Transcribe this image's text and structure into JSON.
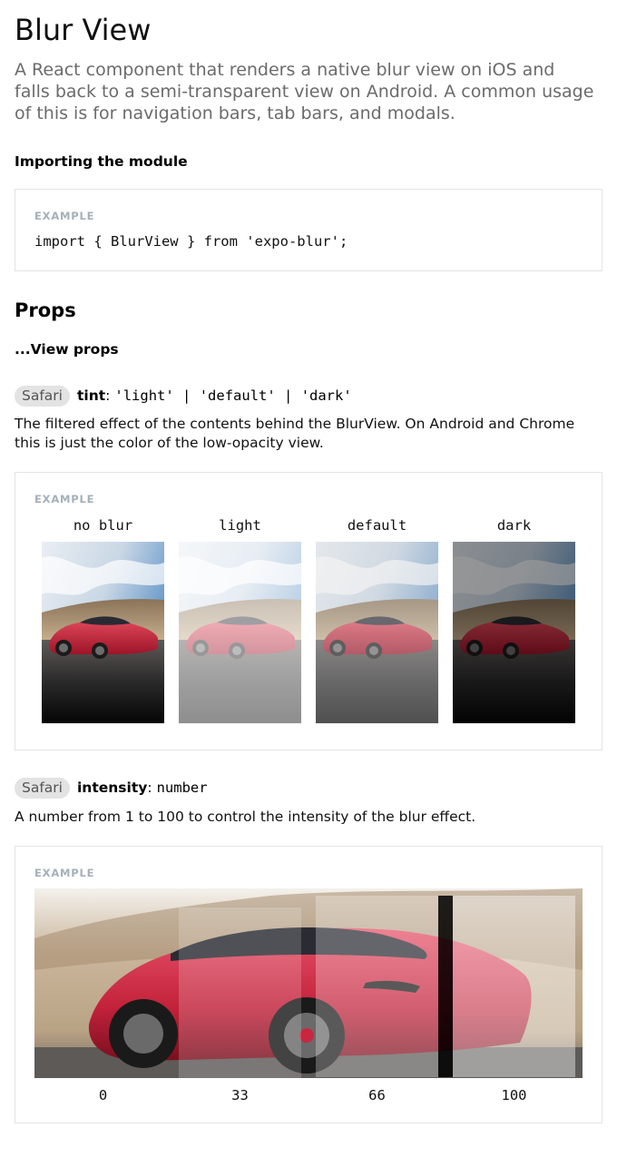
{
  "page": {
    "title": "Blur View",
    "lead": "A React component that renders a native blur view on iOS and falls back to a semi-transparent view on Android. A common usage of this is for navigation bars, tab bars, and modals."
  },
  "importing": {
    "heading": "Importing the module",
    "example_label": "EXAMPLE",
    "code": "import { BlurView } from 'expo-blur';"
  },
  "props": {
    "heading": "Props",
    "subheading": "...View props"
  },
  "tint": {
    "badge": "Safari",
    "name": "tint",
    "colon": ":",
    "type": "'light' | 'default' | 'dark'",
    "description": "The filtered effect of the contents behind the BlurView. On Android and Chrome this is just the color of the low-opacity view.",
    "example_label": "EXAMPLE",
    "variants": [
      "no blur",
      "light",
      "default",
      "dark"
    ]
  },
  "intensity": {
    "badge": "Safari",
    "name": "intensity",
    "colon": ":",
    "type": "number",
    "description": "A number from 1 to 100 to control the intensity of the blur effect.",
    "example_label": "EXAMPLE",
    "values": [
      "0",
      "33",
      "66",
      "100"
    ]
  },
  "colors": {
    "car_red": "#c8283f",
    "sky_blue": "#5b8fc3",
    "label_gray": "#a4b0ba",
    "badge_bg": "#e3e3e3",
    "border": "#e4e4e4"
  }
}
